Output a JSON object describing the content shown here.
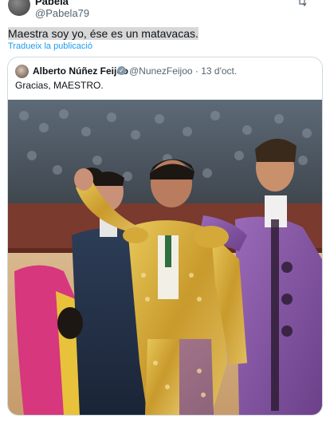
{
  "post": {
    "name": "Pabela",
    "handle": "@Pabela79",
    "text_highlight": "Maestra soy yo, ése es un matavacas.",
    "translate": "Tradueix la publicació"
  },
  "quote": {
    "name": "Alberto Núñez Feijóo",
    "handle_date": "@NunezFeijoo · 13 d'oct.",
    "text": "Gracias, MAESTRO."
  },
  "icons": {
    "repost": "repost-icon",
    "verified": "verified-badge-icon"
  },
  "colors": {
    "link": "#1d9bf0",
    "muted": "#536471",
    "border": "#cfd9de"
  }
}
